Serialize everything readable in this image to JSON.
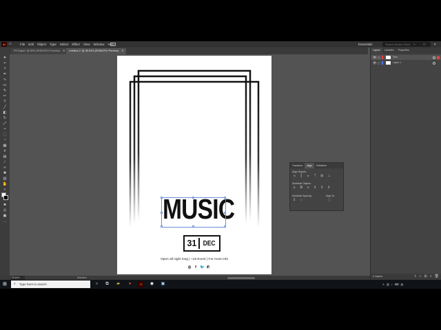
{
  "app": {
    "logo": "Ai",
    "menu": [
      "File",
      "Edit",
      "Object",
      "Type",
      "Select",
      "Effect",
      "View",
      "Window",
      "Help"
    ],
    "workspace": "Essentials",
    "search_placeholder": "Search Adobe Stock"
  },
  "doc_tabs": [
    {
      "label": "PKTvajkn* @ 80% (RGB/GPU Preview)",
      "active": false
    },
    {
      "label": "Untitled-1* @ 95.64% (RGB/GPU Preview)",
      "active": true
    }
  ],
  "poster": {
    "headline": "MUSIC",
    "date_day": "31",
    "date_month": "DEC",
    "tagline": "Open all night long | +18 Event | For more info",
    "socials": [
      "instagram-icon",
      "facebook-icon",
      "twitter-icon",
      "whatsapp-icon"
    ]
  },
  "align_panel": {
    "tabs": [
      "Transform",
      "Align",
      "Pathfinder"
    ],
    "active_tab": "Align",
    "align_objects_label": "Align Objects:",
    "distribute_objects_label": "Distribute Objects:",
    "distribute_spacing_label": "Distribute Spacing:",
    "align_to_label": "Align To:"
  },
  "layers_panel": {
    "tabs": [
      "Layers",
      "Libraries",
      "Properties"
    ],
    "active_tab": "Layers",
    "layers": [
      {
        "name": "Text",
        "color": "#ff3b3b"
      },
      {
        "name": "Layer 1",
        "color": "#4f7bff"
      }
    ],
    "footer_label": "2 Layers"
  },
  "status": {
    "zoom": "95.64%",
    "tool": "Selection"
  },
  "taskbar": {
    "search_placeholder": "Type here to search"
  }
}
